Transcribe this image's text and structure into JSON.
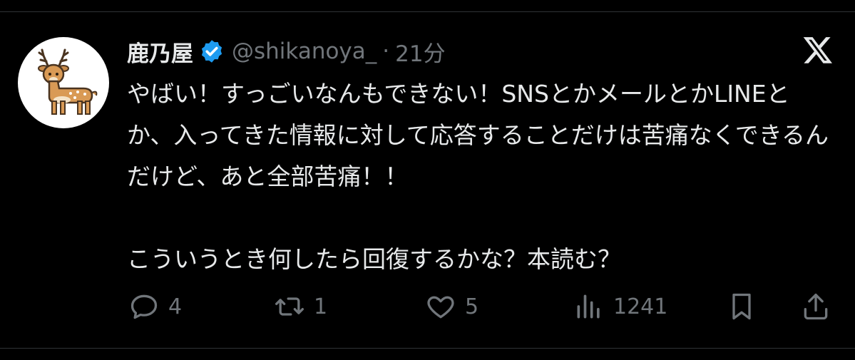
{
  "tweet": {
    "display_name": "鹿乃屋",
    "handle": "@shikanoya_",
    "separator": "·",
    "time": "21分",
    "text": "やばい！すっごいなんもできない！SNSとかメールとかLINEとか、入ってきた情報に対して応答することだけは苦痛なくできるんだけど、あと全部苦痛！！\n\nこういうとき何したら回復するかな？本読む？",
    "verified": true
  },
  "actions": {
    "reply_count": "4",
    "retweet_count": "1",
    "like_count": "5",
    "views_count": "1241"
  },
  "icons": {
    "avatar": "deer-illustration",
    "badge": "verified-badge-icon",
    "platform": "x-logo-icon",
    "reply": "reply-icon",
    "retweet": "retweet-icon",
    "like": "heart-icon",
    "views": "views-chart-icon",
    "bookmark": "bookmark-icon",
    "share": "share-icon"
  },
  "colors": {
    "background": "#000000",
    "text": "#e7e9ea",
    "muted": "#71767b",
    "verified": "#1d9bf0",
    "divider": "#2f3336"
  }
}
